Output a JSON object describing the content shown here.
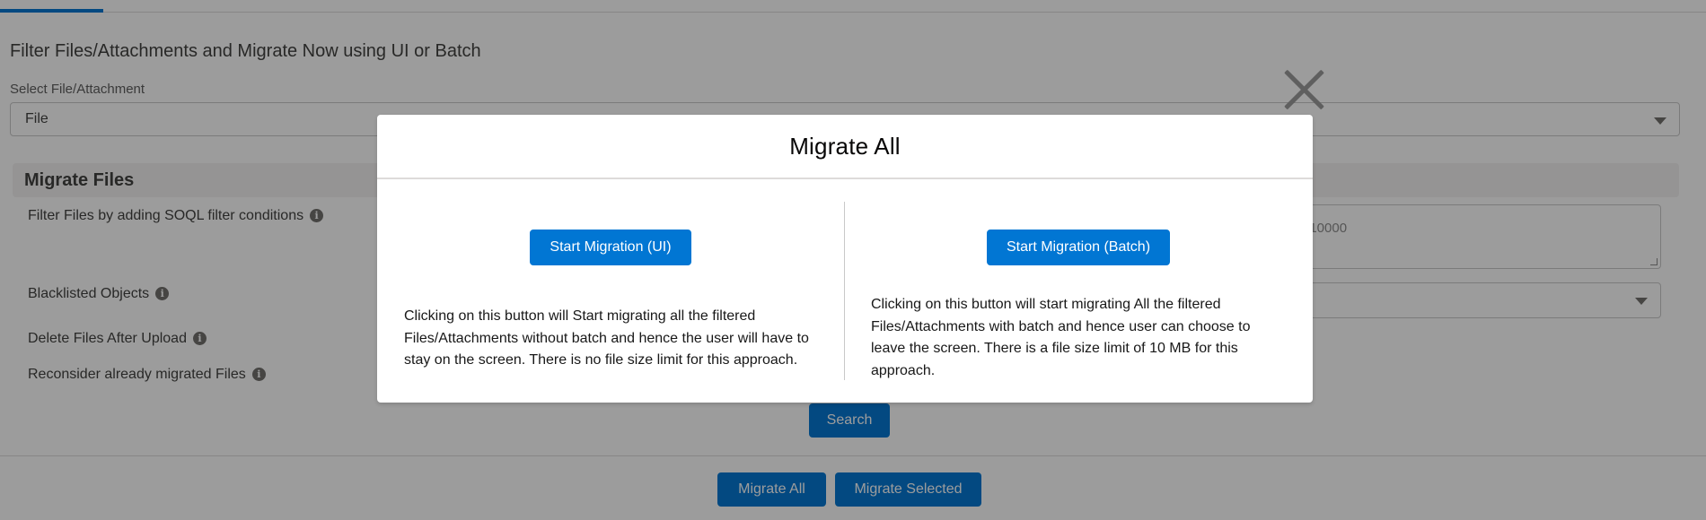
{
  "page": {
    "title": "Filter Files/Attachments and Migrate Now using UI or Batch",
    "select_label": "Select File/Attachment",
    "select_value": "File",
    "section_title": "Migrate Files",
    "fields": {
      "filter_label": "Filter Files by adding SOQL filter conditions",
      "blacklisted_label": "Blacklisted Objects",
      "delete_label": "Delete Files After Upload",
      "reconsider_label": "Reconsider already migrated Files"
    },
    "soql_placeholder_visible": ": 10000",
    "buttons": {
      "search": "Search",
      "migrate_all": "Migrate All",
      "migrate_selected": "Migrate Selected"
    }
  },
  "modal": {
    "title": "Migrate All",
    "ui": {
      "button_label": "Start Migration (UI)",
      "description": "Clicking on this button will Start migrating all the filtered Files/Attachments without batch and hence the user will have to stay on the screen. There is no file size limit for this approach."
    },
    "batch": {
      "button_label": "Start Migration (Batch)",
      "description": "Clicking on this button will start migrating All the filtered Files/Attachments with batch and hence user can choose to leave the screen. There is a file size limit of 10 MB for this approach."
    }
  },
  "icons": {
    "close": "close-icon",
    "info": "info-icon",
    "chevron": "chevron-down-icon"
  },
  "colors": {
    "brand": "#0176d3",
    "backdrop": "rgba(8,7,7,0.4)"
  }
}
